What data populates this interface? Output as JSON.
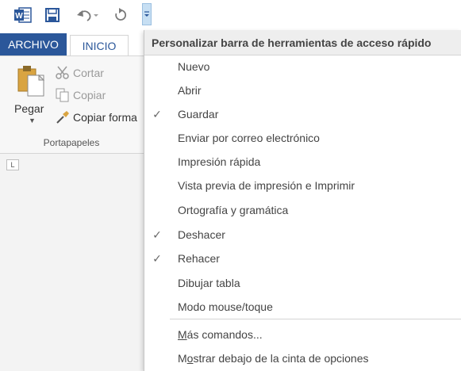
{
  "colors": {
    "ribbon_blue": "#2b579a",
    "accent_red": "#c43e1c",
    "customize_highlight": "#c7dff3"
  },
  "quick_access": {
    "icons": [
      "word-icon",
      "save-icon",
      "undo-icon",
      "redo-icon",
      "customize-qat-icon"
    ]
  },
  "ribbon": {
    "tabs": [
      "ARCHIVO",
      "INICIO"
    ],
    "paste_label": "Pegar",
    "cut_label": "Cortar",
    "copy_label": "Copiar",
    "format_painter_label": "Copiar forma",
    "group_label": "Portapapeles",
    "ruler_corner": "L"
  },
  "menu": {
    "header": "Personalizar barra de herramientas de acceso rápido",
    "items": [
      {
        "label": "Nuevo",
        "checked": false
      },
      {
        "label": "Abrir",
        "checked": false
      },
      {
        "label": "Guardar",
        "checked": true
      },
      {
        "label": "Enviar por correo electrónico",
        "checked": false
      },
      {
        "label": "Impresión rápida",
        "checked": false
      },
      {
        "label": "Vista previa de impresión e Imprimir",
        "checked": false
      },
      {
        "label": "Ortografía y gramática",
        "checked": false
      },
      {
        "label": "Deshacer",
        "checked": true
      },
      {
        "label": "Rehacer",
        "checked": true
      },
      {
        "label": "Dibujar tabla",
        "checked": false
      },
      {
        "label": "Modo mouse/toque",
        "checked": false
      }
    ],
    "more_commands": {
      "accel": "M",
      "rest": "ás comandos..."
    },
    "show_below": {
      "pre": "M",
      "accel": "o",
      "rest": "strar debajo de la cinta de opciones"
    },
    "check_glyph": "✓"
  }
}
